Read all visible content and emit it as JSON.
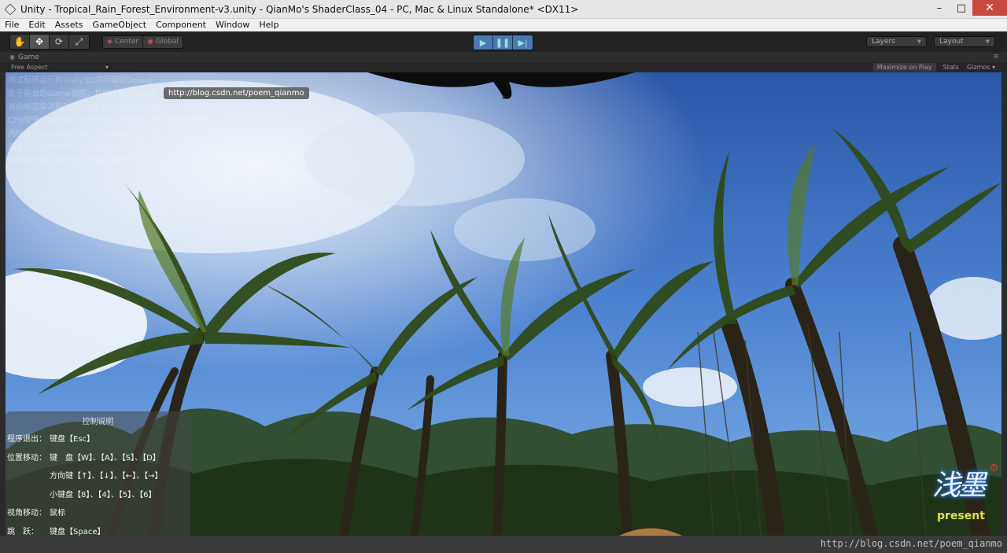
{
  "window": {
    "title": "Unity - Tropical_Rain_Forest_Environment-v3.unity - QianMo's ShaderClass_04 - PC, Mac & Linux Standalone* <DX11>",
    "minimize": "–",
    "maximize": "□",
    "close": "✕"
  },
  "menu": [
    "File",
    "Edit",
    "Assets",
    "GameObject",
    "Component",
    "Window",
    "Help"
  ],
  "toolbar": {
    "tools": [
      "hand-icon",
      "move-icon",
      "rotate-icon",
      "scale-icon"
    ],
    "pivot": "Center",
    "space": "Global",
    "play": [
      "play-icon",
      "pause-icon",
      "step-icon"
    ],
    "layers": "Layers",
    "layout": "Layout"
  },
  "game": {
    "tab": "Game",
    "aspect": "Free Aspect",
    "maximize_on_play": "Maximize on Play",
    "stats": "Stats",
    "gizmos": "Gizmos"
  },
  "overlay": {
    "url_tip": "http://blog.csdn.net/poem_qianmo",
    "stats_lines": [
      "测试程序运行的Unity3D游戏编辑Debug",
      "处于前台的Game视图，其他渲染文本信息",
      "当前帧渲染消耗时间：9.4 ms (106 帧每秒)",
      "CPU型号：Intel(R) Core(TM) i5-4590 CPU @ 2.50GHz",
      "内核数：4 core核心数，7919MB 内存",
      "显卡型号：NVIDIA GeForce GTX 750 Ti",
      "1920x768 60Hz (2072MB 显存)"
    ],
    "help": {
      "title": "控制说明",
      "rows": [
        {
          "label": "程序退出：",
          "value": "键盘【Esc】"
        },
        {
          "label": "位置移动：",
          "value": "键　盘【W】、【A】、【S】、【D】"
        },
        {
          "label": "",
          "value": "方向键【↑】、【↓】、【←】、【→】"
        },
        {
          "label": "",
          "value": "小键盘【8】、【4】、【5】、【6】"
        },
        {
          "label": "视角移动：",
          "value": "鼠标"
        },
        {
          "label": "跳　跃：",
          "value": "键盘【Space】"
        }
      ]
    },
    "logo_mark": "浅墨",
    "logo_sub": "present",
    "logo_reg": "R"
  },
  "watermark": "http://blog.csdn.net/poem_qianmo",
  "colors": {
    "sky_top": "#2f5fb0",
    "sky_mid": "#5b8fd6",
    "cloud": "#f2f6fb",
    "foliage_dark": "#1d2a12",
    "foliage": "#4a6b22",
    "trunk": "#2a2418",
    "play_accent": "#4a78b0"
  }
}
